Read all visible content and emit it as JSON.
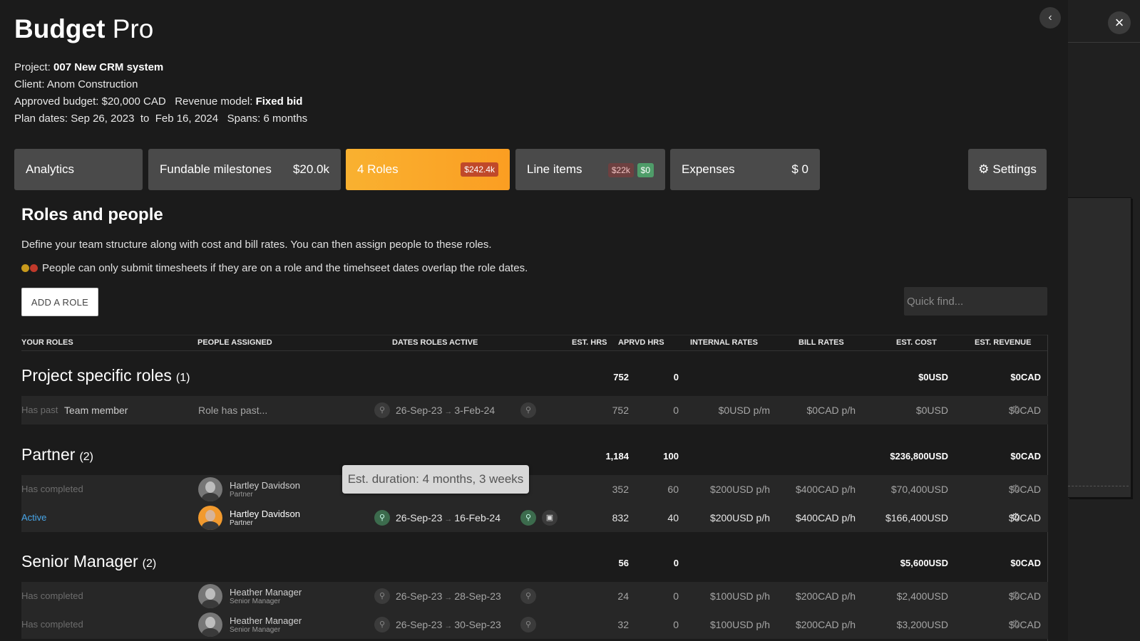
{
  "app": {
    "title_bold": "Budget",
    "title_rest": "Pro",
    "close_icon": "×",
    "back_icon": "‹"
  },
  "project": {
    "project_label": "Project:",
    "project_name": "007 New CRM system",
    "client_label": "Client:",
    "client_name": "Anom Construction",
    "budget_label": "Approved budget:",
    "budget_value": "$20,000 CAD",
    "revenue_label": "Revenue model:",
    "revenue_value": "Fixed bid",
    "plan_label": "Plan dates:",
    "plan_start": "Sep 26, 2023",
    "plan_to": "to",
    "plan_end": "Feb 16, 2024",
    "spans_label": "Spans:",
    "spans_value": "6 months"
  },
  "tabs": {
    "analytics": {
      "label": "Analytics"
    },
    "milestones": {
      "label": "Fundable milestones",
      "value": "$20.0k"
    },
    "roles": {
      "label": "4 Roles",
      "value": "$242.4k"
    },
    "line_items": {
      "label": "Line items",
      "value_a": "$22k",
      "value_b": "$0"
    },
    "expenses": {
      "label": "Expenses",
      "value": "$ 0"
    },
    "settings": {
      "label": "Settings",
      "icon": "gear-icon"
    }
  },
  "section": {
    "title": "Roles and people",
    "desc1": "Define your team structure along with cost and bill rates. You can then assign people to these roles.",
    "desc2": "People can only submit timesheets if they are on a role and the timehseet dates overlap the role dates.",
    "add_role": "ADD A ROLE",
    "quick_find_placeholder": "Quick find..."
  },
  "table": {
    "headers": {
      "roles": "YOUR ROLES",
      "people": "PEOPLE ASSIGNED",
      "dates": "DATES ROLES ACTIVE",
      "est_hrs": "EST. HRS",
      "aprvd_hrs": "APRVD HRS",
      "internal": "INTERNAL RATES",
      "bill": "BILL RATES",
      "est_cost": "EST. COST",
      "est_revenue": "EST. REVENUE"
    },
    "groups": [
      {
        "name": "Project specific roles",
        "count": "(1)",
        "est_hrs": "752",
        "aprvd_hrs": "0",
        "est_cost": "$0USD",
        "est_revenue": "$0CAD"
      },
      {
        "name": "Partner",
        "count": "(2)",
        "est_hrs": "1,184",
        "aprvd_hrs": "100",
        "est_cost": "$236,800USD",
        "est_revenue": "$0CAD"
      },
      {
        "name": "Senior Manager",
        "count": "(2)",
        "est_hrs": "56",
        "aprvd_hrs": "0",
        "est_cost": "$5,600USD",
        "est_revenue": "$0CAD"
      }
    ],
    "rows": [
      {
        "status": "Has past",
        "role": "Team member",
        "people": "Role has past...",
        "start": "26-Sep-23",
        "end": "3-Feb-24",
        "est_hrs": "752",
        "aprvd_hrs": "0",
        "internal": "$0USD p/m",
        "bill": "$0CAD p/h",
        "est_cost": "$0USD",
        "est_revenue": "$0CAD"
      },
      {
        "status": "Has completed",
        "person": "Hartley Davidson",
        "person_role": "Partner",
        "start": "",
        "end": "",
        "est_hrs": "352",
        "aprvd_hrs": "60",
        "internal": "$200USD p/h",
        "bill": "$400CAD p/h",
        "est_cost": "$70,400USD",
        "est_revenue": "$0CAD"
      },
      {
        "status": "Active",
        "person": "Hartley Davidson",
        "person_role": "Partner",
        "start": "26-Sep-23",
        "end": "16-Feb-24",
        "est_hrs": "832",
        "aprvd_hrs": "40",
        "internal": "$200USD p/h",
        "bill": "$400CAD p/h",
        "est_cost": "$166,400USD",
        "est_revenue": "$0CAD"
      },
      {
        "status": "Has completed",
        "person": "Heather Manager",
        "person_role": "Senior Manager",
        "start": "26-Sep-23",
        "end": "28-Sep-23",
        "est_hrs": "24",
        "aprvd_hrs": "0",
        "internal": "$100USD p/h",
        "bill": "$200CAD p/h",
        "est_cost": "$2,400USD",
        "est_revenue": "$0CAD"
      },
      {
        "status": "Has completed",
        "person": "Heather Manager",
        "person_role": "Senior Manager",
        "start": "26-Sep-23",
        "end": "30-Sep-23",
        "est_hrs": "32",
        "aprvd_hrs": "0",
        "internal": "$100USD p/h",
        "bill": "$200CAD p/h",
        "est_cost": "$3,200USD",
        "est_revenue": "$0CAD"
      }
    ]
  },
  "tooltip": {
    "text": "Est. duration: 4 months, 3 weeks"
  },
  "colors": {
    "accent": "#fb9e22",
    "active_link": "#48a6e8",
    "background": "#1b1b1b"
  }
}
